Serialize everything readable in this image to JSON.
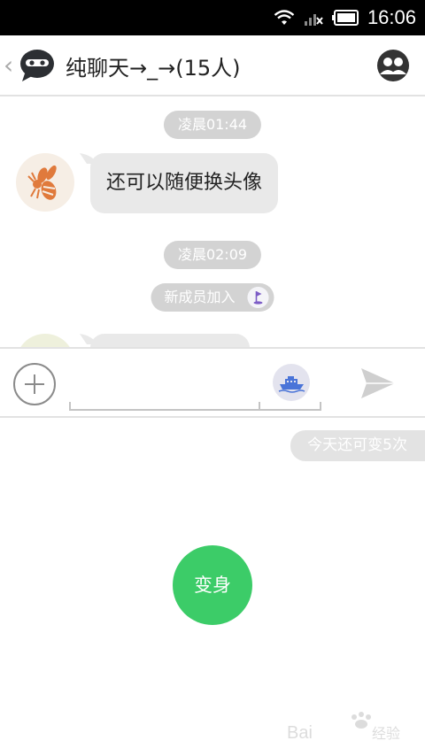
{
  "status_bar": {
    "time": "16:06",
    "icons": [
      "wifi-icon",
      "cell-signal-icon",
      "battery-icon"
    ]
  },
  "header": {
    "back_icon": "chevron-left-icon",
    "chat_icon": "ninja-avatar-icon",
    "title": "纯聊天→_→(15人)",
    "members_icon": "group-members-icon"
  },
  "messages": [
    {
      "type": "time",
      "text": "凌晨01:44"
    },
    {
      "type": "message",
      "avatar": "wasp-avatar",
      "text": "还可以随便换头像"
    },
    {
      "type": "time",
      "text": "凌晨02:09"
    },
    {
      "type": "system",
      "text": "新成员加入",
      "icon": "flag-icon"
    }
  ],
  "input_bar": {
    "add_icon": "plus-circle-icon",
    "input_value": "",
    "input_placeholder": "",
    "boat_icon": "boat-icon",
    "send_icon": "send-icon"
  },
  "transform_panel": {
    "remaining_text": "今天还可变5次",
    "transform_label": "变身"
  },
  "colors": {
    "accent_green": "#3ccc68",
    "pill_gray": "#d3d3d3",
    "bubble_gray": "#e9e9e9",
    "icon_gray": "#8b8b8b",
    "wasp_orange": "#e07a3c",
    "boat_blue": "#4a74d8",
    "flag_purple": "#7c5cc6"
  }
}
